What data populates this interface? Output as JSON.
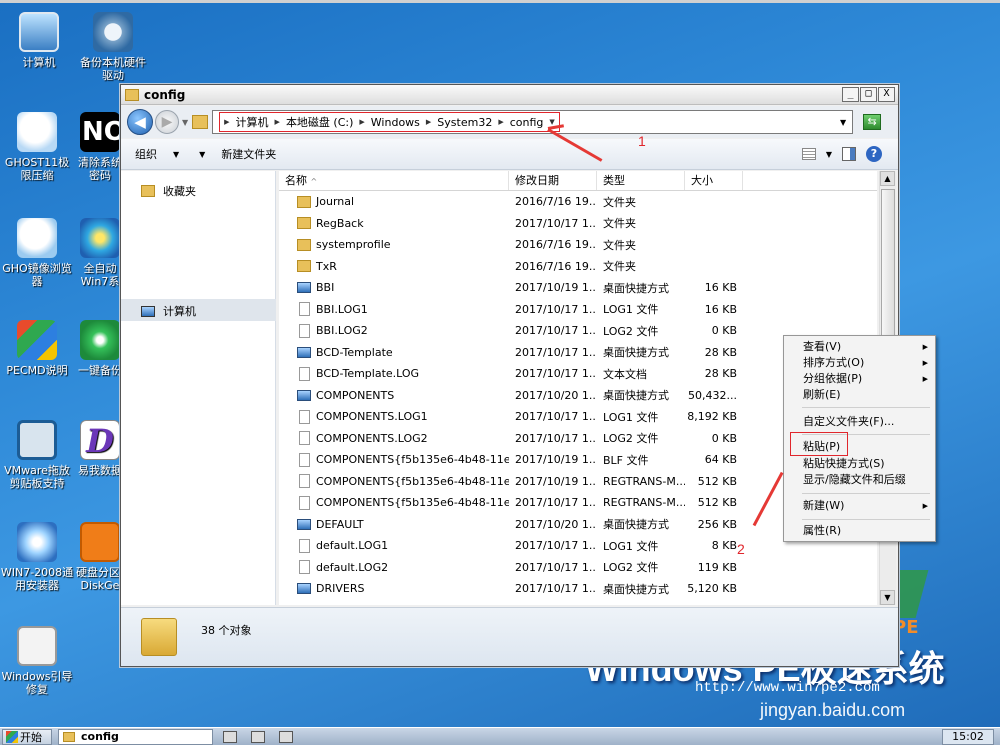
{
  "desktop": {
    "icons": [
      {
        "label": "计算机"
      },
      {
        "label": "备份本机硬件驱动"
      },
      {
        "label": "GHOST11极限压缩"
      },
      {
        "label": "清除系统密码"
      },
      {
        "label": "GHO镜像浏览器"
      },
      {
        "label": "全自动Win7系"
      },
      {
        "label": "PECMD说明"
      },
      {
        "label": "一键备份"
      },
      {
        "label": "VMware拖放剪贴板支持"
      },
      {
        "label": "易我数据"
      },
      {
        "label": "WIN7-2008通用安装器"
      },
      {
        "label": "硬盘分区-DiskGe"
      },
      {
        "label": "Windows引导修复"
      }
    ],
    "brand_text": "Windows PE极速系统",
    "brand_tag": "PE",
    "brand_url": "http://www.win7pe2.com",
    "watermark": "jingyan.baidu.com"
  },
  "window": {
    "title": "config",
    "controls": {
      "minimize": "_",
      "maximize": "□",
      "close": "X"
    },
    "address": {
      "crumbs": [
        "计算机",
        "本地磁盘 (C:)",
        "Windows",
        "System32",
        "config"
      ]
    },
    "toolbar": {
      "organize": "组织",
      "new_folder": "新建文件夹"
    },
    "nav": {
      "favorites": "收藏夹",
      "computer": "计算机"
    },
    "columns": {
      "name": "名称",
      "date": "修改日期",
      "type": "类型",
      "size": "大小"
    },
    "files": [
      {
        "name": "Journal",
        "date": "2016/7/16 19...",
        "type": "文件夹",
        "size": "",
        "icon": "folder"
      },
      {
        "name": "RegBack",
        "date": "2017/10/17 1...",
        "type": "文件夹",
        "size": "",
        "icon": "folder"
      },
      {
        "name": "systemprofile",
        "date": "2016/7/16 19...",
        "type": "文件夹",
        "size": "",
        "icon": "folder"
      },
      {
        "name": "TxR",
        "date": "2016/7/16 19...",
        "type": "文件夹",
        "size": "",
        "icon": "folder"
      },
      {
        "name": "BBI",
        "date": "2017/10/19 1...",
        "type": "桌面快捷方式",
        "size": "16 KB",
        "icon": "shortcut"
      },
      {
        "name": "BBI.LOG1",
        "date": "2017/10/17 1...",
        "type": "LOG1 文件",
        "size": "16 KB",
        "icon": "file"
      },
      {
        "name": "BBI.LOG2",
        "date": "2017/10/17 1...",
        "type": "LOG2 文件",
        "size": "0 KB",
        "icon": "file"
      },
      {
        "name": "BCD-Template",
        "date": "2017/10/17 1...",
        "type": "桌面快捷方式",
        "size": "28 KB",
        "icon": "shortcut"
      },
      {
        "name": "BCD-Template.LOG",
        "date": "2017/10/17 1...",
        "type": "文本文档",
        "size": "28 KB",
        "icon": "file"
      },
      {
        "name": "COMPONENTS",
        "date": "2017/10/20 1...",
        "type": "桌面快捷方式",
        "size": "50,432...",
        "icon": "shortcut"
      },
      {
        "name": "COMPONENTS.LOG1",
        "date": "2017/10/17 1...",
        "type": "LOG1 文件",
        "size": "8,192 KB",
        "icon": "file"
      },
      {
        "name": "COMPONENTS.LOG2",
        "date": "2017/10/17 1...",
        "type": "LOG2 文件",
        "size": "0 KB",
        "icon": "file"
      },
      {
        "name": "COMPONENTS{f5b135e6-4b48-11e6-...",
        "date": "2017/10/19 1...",
        "type": "BLF 文件",
        "size": "64 KB",
        "icon": "file"
      },
      {
        "name": "COMPONENTS{f5b135e6-4b48-11e6-...",
        "date": "2017/10/19 1...",
        "type": "REGTRANS-M...",
        "size": "512 KB",
        "icon": "file"
      },
      {
        "name": "COMPONENTS{f5b135e6-4b48-11e6-...",
        "date": "2017/10/17 1...",
        "type": "REGTRANS-M...",
        "size": "512 KB",
        "icon": "file"
      },
      {
        "name": "DEFAULT",
        "date": "2017/10/20 1...",
        "type": "桌面快捷方式",
        "size": "256 KB",
        "icon": "shortcut"
      },
      {
        "name": "default.LOG1",
        "date": "2017/10/17 1...",
        "type": "LOG1 文件",
        "size": "8 KB",
        "icon": "file"
      },
      {
        "name": "default.LOG2",
        "date": "2017/10/17 1...",
        "type": "LOG2 文件",
        "size": "119 KB",
        "icon": "file"
      },
      {
        "name": "DRIVERS",
        "date": "2017/10/17 1...",
        "type": "桌面快捷方式",
        "size": "5,120 KB",
        "icon": "shortcut"
      }
    ],
    "status": "38 个对象"
  },
  "context_menu": {
    "items": [
      {
        "label": "查看(V)",
        "submenu": true
      },
      {
        "label": "排序方式(O)",
        "submenu": true
      },
      {
        "label": "分组依据(P)",
        "submenu": true
      },
      {
        "label": "刷新(E)",
        "submenu": false
      },
      {
        "label": "自定义文件夹(F)...",
        "submenu": false
      },
      {
        "label": "粘贴(P)",
        "submenu": false
      },
      {
        "label": "粘贴快捷方式(S)",
        "submenu": false
      },
      {
        "label": "显示/隐藏文件和后缀",
        "submenu": false
      },
      {
        "label": "新建(W)",
        "submenu": true
      },
      {
        "label": "属性(R)",
        "submenu": false
      }
    ]
  },
  "annotations": {
    "one": "1",
    "two": "2"
  },
  "taskbar": {
    "start_label": "开始",
    "task_label": "config",
    "clock": "15:02"
  }
}
